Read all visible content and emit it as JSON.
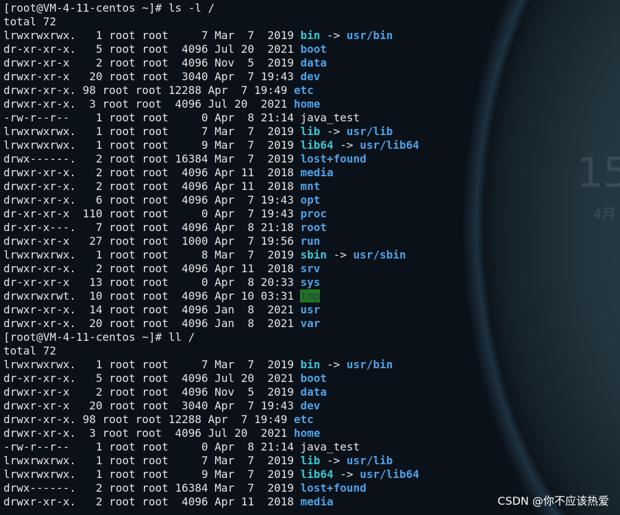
{
  "desktop": {
    "clock_day": "15",
    "clock_month": "4月"
  },
  "watermark": "CSDN @你不应该热爱",
  "colors": {
    "dir": "#4ea3e8",
    "link": "#39c9d6",
    "sticky_bg": "#1f7a1f",
    "text": "#e6e6e6"
  },
  "terminal": {
    "lines": [
      {
        "text": "[root@VM-4-11-centos ~]# ls -l /"
      },
      {
        "text": "total 72"
      },
      {
        "prefix": "lrwxrwxrwx.   1 root root     7 Mar  7  2019 ",
        "name": "bin",
        "type": "link",
        "arrow": " -> ",
        "target": "usr/bin"
      },
      {
        "prefix": "dr-xr-xr-x.   5 root root  4096 Jul 20  2021 ",
        "name": "boot",
        "type": "dir"
      },
      {
        "prefix": "drwxr-xr-x    2 root root  4096 Nov  5  2019 ",
        "name": "data",
        "type": "dir"
      },
      {
        "prefix": "drwxr-xr-x   20 root root  3040 Apr  7 19:43 ",
        "name": "dev",
        "type": "dir"
      },
      {
        "prefix": "drwxr-xr-x. 98 root root 12288 Apr  7 19:49 ",
        "name": "etc",
        "type": "dir"
      },
      {
        "prefix": "drwxr-xr-x.  3 root root  4096 Jul 20  2021 ",
        "name": "home",
        "type": "dir"
      },
      {
        "prefix": "-rw-r--r--    1 root root     0 Apr  8 21:14 ",
        "name": "java_test",
        "type": "file"
      },
      {
        "prefix": "lrwxrwxrwx.   1 root root     7 Mar  7  2019 ",
        "name": "lib",
        "type": "link",
        "arrow": " -> ",
        "target": "usr/lib"
      },
      {
        "prefix": "lrwxrwxrwx.   1 root root     9 Mar  7  2019 ",
        "name": "lib64",
        "type": "link",
        "arrow": " -> ",
        "target": "usr/lib64"
      },
      {
        "prefix": "drwx------.   2 root root 16384 Mar  7  2019 ",
        "name": "lost+found",
        "type": "dir"
      },
      {
        "prefix": "drwxr-xr-x.   2 root root  4096 Apr 11  2018 ",
        "name": "media",
        "type": "dir"
      },
      {
        "prefix": "drwxr-xr-x.   2 root root  4096 Apr 11  2018 ",
        "name": "mnt",
        "type": "dir"
      },
      {
        "prefix": "drwxr-xr-x.   6 root root  4096 Apr  7 19:43 ",
        "name": "opt",
        "type": "dir"
      },
      {
        "prefix": "dr-xr-xr-x  110 root root     0 Apr  7 19:43 ",
        "name": "proc",
        "type": "dir"
      },
      {
        "prefix": "dr-xr-x---.   7 root root  4096 Apr  8 21:18 ",
        "name": "root",
        "type": "dir"
      },
      {
        "prefix": "drwxr-xr-x   27 root root  1000 Apr  7 19:56 ",
        "name": "run",
        "type": "dir"
      },
      {
        "prefix": "lrwxrwxrwx.   1 root root     8 Mar  7  2019 ",
        "name": "sbin",
        "type": "link",
        "arrow": " -> ",
        "target": "usr/sbin"
      },
      {
        "prefix": "drwxr-xr-x.   2 root root  4096 Apr 11  2018 ",
        "name": "srv",
        "type": "dir"
      },
      {
        "prefix": "dr-xr-xr-x   13 root root     0 Apr  8 20:33 ",
        "name": "sys",
        "type": "dir"
      },
      {
        "prefix": "drwxrwxrwt.  10 root root  4096 Apr 10 03:31 ",
        "name": "tmp",
        "type": "sticky"
      },
      {
        "prefix": "drwxr-xr-x.  14 root root  4096 Jan  8  2021 ",
        "name": "usr",
        "type": "dir"
      },
      {
        "prefix": "drwxr-xr-x.  20 root root  4096 Jan  8  2021 ",
        "name": "var",
        "type": "dir"
      },
      {
        "text": "[root@VM-4-11-centos ~]# ll /"
      },
      {
        "text": "total 72"
      },
      {
        "prefix": "lrwxrwxrwx.   1 root root     7 Mar  7  2019 ",
        "name": "bin",
        "type": "link",
        "arrow": " -> ",
        "target": "usr/bin"
      },
      {
        "prefix": "dr-xr-xr-x.   5 root root  4096 Jul 20  2021 ",
        "name": "boot",
        "type": "dir"
      },
      {
        "prefix": "drwxr-xr-x    2 root root  4096 Nov  5  2019 ",
        "name": "data",
        "type": "dir"
      },
      {
        "prefix": "drwxr-xr-x   20 root root  3040 Apr  7 19:43 ",
        "name": "dev",
        "type": "dir"
      },
      {
        "prefix": "drwxr-xr-x. 98 root root 12288 Apr  7 19:49 ",
        "name": "etc",
        "type": "dir"
      },
      {
        "prefix": "drwxr-xr-x.  3 root root  4096 Jul 20  2021 ",
        "name": "home",
        "type": "dir"
      },
      {
        "prefix": "-rw-r--r--    1 root root     0 Apr  8 21:14 ",
        "name": "java_test",
        "type": "file"
      },
      {
        "prefix": "lrwxrwxrwx.   1 root root     7 Mar  7  2019 ",
        "name": "lib",
        "type": "link",
        "arrow": " -> ",
        "target": "usr/lib"
      },
      {
        "prefix": "lrwxrwxrwx.   1 root root     9 Mar  7  2019 ",
        "name": "lib64",
        "type": "link",
        "arrow": " -> ",
        "target": "usr/lib64"
      },
      {
        "prefix": "drwx------.   2 root root 16384 Mar  7  2019 ",
        "name": "lost+found",
        "type": "dir"
      },
      {
        "prefix": "drwxr-xr-x.   2 root root  4096 Apr 11  2018 ",
        "name": "media",
        "type": "dir"
      }
    ]
  }
}
